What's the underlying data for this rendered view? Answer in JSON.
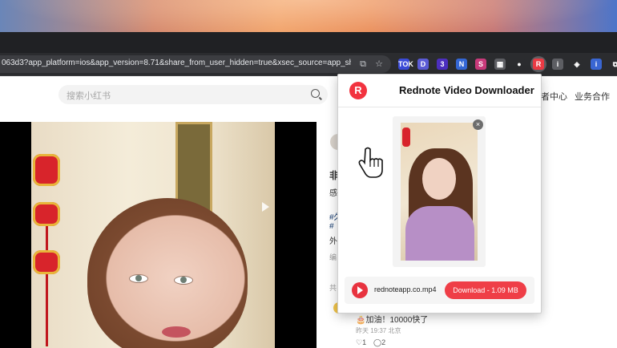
{
  "browser": {
    "url": "063d3?app_platform=ios&app_version=8.71&share_from_user_hidden=true&xsec_source=app_share&...",
    "extensions": [
      {
        "name": "tiktok-ext-icon",
        "label": "TOK",
        "color": "#3b4bd8"
      },
      {
        "name": "d-ext-icon",
        "label": "D",
        "color": "#5b5bd6"
      },
      {
        "name": "blue-ext-icon",
        "label": "3",
        "color": "#4c2fbf"
      },
      {
        "name": "ni-ext-icon",
        "label": "N",
        "color": "#3467d6"
      },
      {
        "name": "pink-ext-icon",
        "label": "S",
        "color": "#c93a7b"
      },
      {
        "name": "grid-ext-icon",
        "label": "▦",
        "color": "#5d5e63"
      },
      {
        "name": "circle-ext-icon",
        "label": "●",
        "color": "#2b2c2f"
      },
      {
        "name": "rednote-ext-icon",
        "label": "R",
        "color": "#ea3a44"
      },
      {
        "name": "info-ext-icon",
        "label": "i",
        "color": "#5d5e63"
      },
      {
        "name": "color-ext-icon",
        "label": "◈",
        "color": "#2b2c2f"
      },
      {
        "name": "shield-ext-icon",
        "label": "i",
        "color": "#3a66d2"
      },
      {
        "name": "puzzle-ext-icon",
        "label": "⧉",
        "color": "#2b2c2f"
      }
    ]
  },
  "site": {
    "search_placeholder": "搜索小红书",
    "nav_partial": "者中心",
    "nav_business": "业务合作"
  },
  "post": {
    "title_partial": "非",
    "line1": "感",
    "tag1": "#久",
    "tag2": "#",
    "line4": "外",
    "edit": "编",
    "share": "共",
    "comment_text": "加油！10000快了",
    "comment_meta": "昨天 19:37 北京",
    "likes": "1",
    "replies": "2"
  },
  "popup": {
    "logo": "R",
    "title": "Rednote Video Downloader",
    "close": "×",
    "file_name": "rednoteapp.co.mp4",
    "download_label": "Download - 1.09 MB"
  }
}
